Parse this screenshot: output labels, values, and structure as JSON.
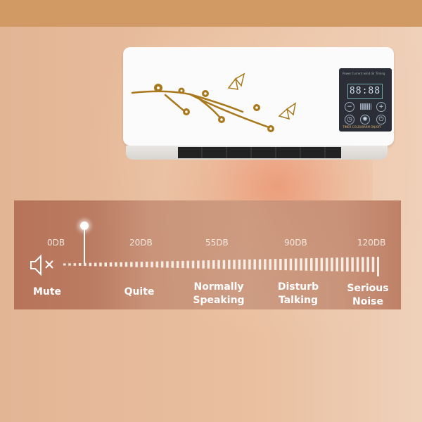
{
  "panel": {
    "top_labels": "Power  Current wind dir  Timing",
    "display": "88:88",
    "minus": "−",
    "plus": "+",
    "bottom_labels": "TIMER  COLD/WARM  ON/OFF"
  },
  "scale": {
    "levels": [
      {
        "db": "0DB",
        "label_lines": [
          "Mute"
        ]
      },
      {
        "db": "20DB",
        "label_lines": [
          "Quite"
        ]
      },
      {
        "db": "55DB",
        "label_lines": [
          "Normally",
          "Speaking"
        ]
      },
      {
        "db": "90DB",
        "label_lines": [
          "Disturb",
          "Talking"
        ]
      },
      {
        "db": "120DB",
        "label_lines": [
          "Serious",
          "Noise"
        ]
      }
    ],
    "marker_value_db": 10,
    "range_db": [
      0,
      120
    ]
  },
  "icons": {
    "mute": "speaker-muted-icon"
  },
  "colors": {
    "top_band": "#d19a64",
    "decal": "#a8781c",
    "strip": "#b9775c"
  }
}
